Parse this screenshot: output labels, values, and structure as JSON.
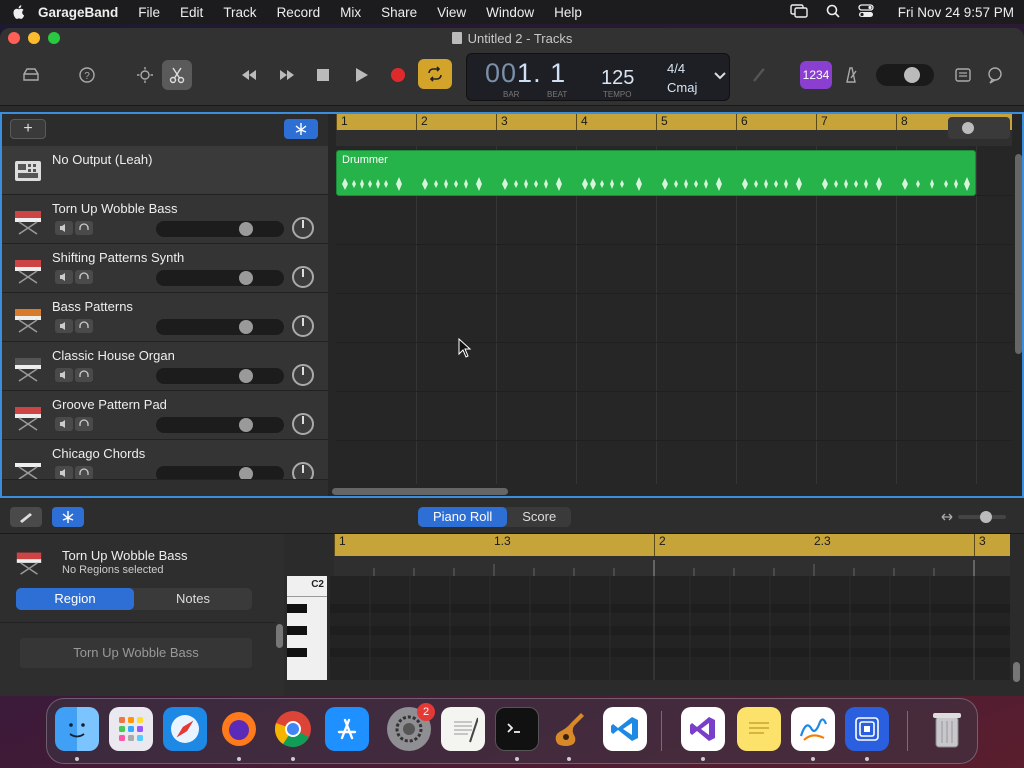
{
  "menubar": {
    "app": "GarageBand",
    "items": [
      "File",
      "Edit",
      "Track",
      "Record",
      "Mix",
      "Share",
      "View",
      "Window",
      "Help"
    ],
    "clock": "Fri Nov 24  9:57 PM"
  },
  "window": {
    "title": "Untitled 2 - Tracks"
  },
  "lcd": {
    "bar_dim": "00",
    "position": "1. 1",
    "bar_label": "BAR",
    "beat_label": "BEAT",
    "tempo": "125",
    "tempo_label": "TEMPO",
    "signature": "4/4",
    "key": "Cmaj"
  },
  "toolbar": {
    "count_in": "1234"
  },
  "ruler": {
    "bars": [
      "1",
      "2",
      "3",
      "4",
      "5",
      "6",
      "7",
      "8"
    ]
  },
  "tracks": [
    {
      "name": "No Output (Leah)",
      "kind": "drummer"
    },
    {
      "name": "Torn Up Wobble Bass",
      "kind": "synth"
    },
    {
      "name": "Shifting Patterns Synth",
      "kind": "synth"
    },
    {
      "name": "Bass Patterns",
      "kind": "synth"
    },
    {
      "name": "Classic House Organ",
      "kind": "keys"
    },
    {
      "name": "Groove Pattern Pad",
      "kind": "synth"
    },
    {
      "name": "Chicago Chords",
      "kind": "keys"
    }
  ],
  "region": {
    "name": "Drummer"
  },
  "editor": {
    "tabs": [
      "Piano Roll",
      "Score"
    ],
    "active_tab": "Piano Roll",
    "track_name": "Torn Up Wobble Bass",
    "status": "No Regions selected",
    "inspector_tabs": [
      "Region",
      "Notes"
    ],
    "region_name": "Torn Up Wobble Bass",
    "ruler": [
      "1",
      "1.3",
      "2",
      "2.3",
      "3"
    ],
    "key_label": "C2"
  },
  "dock": {
    "items": [
      "Finder",
      "Launchpad",
      "Safari",
      "Firefox",
      "Chrome",
      "App Store",
      "System Settings",
      "TextEdit",
      "Terminal",
      "GarageBand",
      "Visual Studio Code",
      "Visual Studio",
      "Stickies",
      "Freeform",
      "Screen Sharing",
      "Trash"
    ],
    "settings_badge": "2"
  },
  "colors": {
    "accent": "#2e6fd6",
    "ruler": "#c6a43a",
    "region": "#25b34a",
    "record": "#e0292b",
    "cycle": "#d4a32a",
    "count_in": "#8a3fd0"
  }
}
